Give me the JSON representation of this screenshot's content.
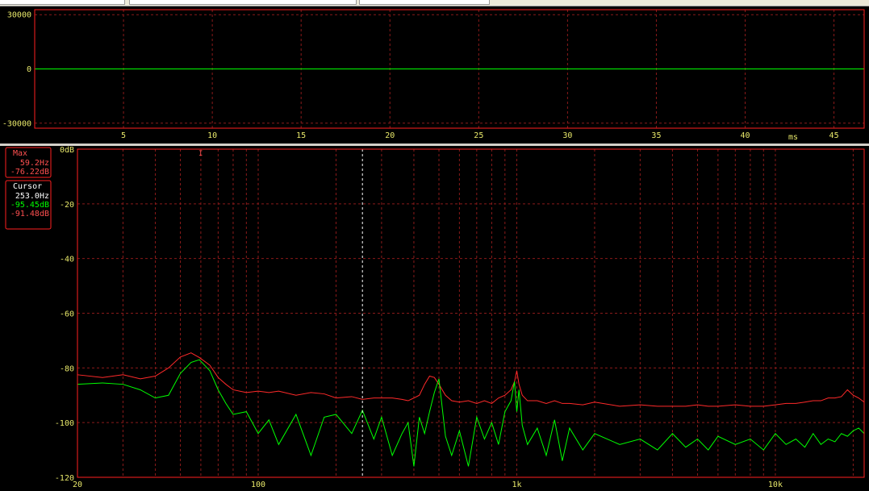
{
  "chart_data": [
    {
      "type": "line",
      "title": "",
      "xunit": "ms",
      "xlim": [
        0,
        46.7
      ],
      "ylim": [
        -32768,
        32767
      ],
      "x_ticks": [
        "5",
        "10",
        "15",
        "20",
        "25",
        "30",
        "35",
        "40",
        "45"
      ],
      "y_ticks": [
        "30000",
        "0",
        "-30000"
      ],
      "grid": true,
      "series": [
        {
          "color": "#00ff00",
          "x": [
            0,
            46.7
          ],
          "y": [
            0,
            0
          ]
        }
      ]
    },
    {
      "type": "line",
      "title": "",
      "xscale": "log",
      "xlim": [
        20,
        22050
      ],
      "ylim": [
        -120,
        0
      ],
      "x_tick_labels": [
        {
          "x": 20,
          "label": "20"
        },
        {
          "x": 100,
          "label": "100"
        },
        {
          "x": 1000,
          "label": "1k"
        },
        {
          "x": 10000,
          "label": "10k"
        }
      ],
      "y_tick_labels": [
        {
          "y": 0,
          "label": "0dB"
        },
        {
          "y": -20,
          "label": "-20"
        },
        {
          "y": -40,
          "label": "-40"
        },
        {
          "y": -60,
          "label": "-60"
        },
        {
          "y": -80,
          "label": "-80"
        },
        {
          "y": -100,
          "label": "-100"
        },
        {
          "y": -120,
          "label": "-120"
        }
      ],
      "grid": true,
      "cursor_x": 253.0,
      "max_marker_x": 59.2,
      "series": [
        {
          "color": "#ff2a2a",
          "x": [
            20,
            25,
            30,
            35,
            40,
            45,
            50,
            55,
            59.2,
            65,
            70,
            75,
            80,
            90,
            100,
            110,
            120,
            140,
            160,
            180,
            200,
            230,
            253,
            280,
            300,
            330,
            360,
            380,
            400,
            420,
            440,
            460,
            480,
            500,
            530,
            560,
            600,
            650,
            700,
            750,
            800,
            850,
            900,
            950,
            980,
            1000,
            1020,
            1050,
            1100,
            1200,
            1300,
            1400,
            1500,
            1600,
            1800,
            2000,
            2500,
            3000,
            3500,
            4000,
            4500,
            5000,
            5500,
            6000,
            7000,
            8000,
            9000,
            10000,
            11000,
            12000,
            13000,
            14000,
            15000,
            16000,
            17000,
            18000,
            19000,
            20000,
            21000,
            22050
          ],
          "y": [
            -82.5,
            -83.5,
            -82.5,
            -84,
            -83,
            -80,
            -76,
            -74.5,
            -76.2,
            -79,
            -83.5,
            -86,
            -88,
            -89,
            -88.5,
            -89,
            -88.5,
            -90,
            -89,
            -89.5,
            -91,
            -90.5,
            -91.5,
            -91,
            -91,
            -91,
            -91.5,
            -92,
            -91,
            -90,
            -86,
            -83,
            -83.5,
            -86,
            -90,
            -92,
            -92.5,
            -92,
            -93,
            -92,
            -93,
            -91,
            -90,
            -88,
            -85,
            -81,
            -86,
            -90,
            -92,
            -92,
            -93,
            -92,
            -93,
            -93,
            -93.5,
            -92.5,
            -94,
            -93.5,
            -94,
            -94,
            -94,
            -93.5,
            -94,
            -94,
            -93.5,
            -94,
            -94,
            -93.5,
            -93,
            -93,
            -92.5,
            -92,
            -92,
            -91,
            -91,
            -90.5,
            -88,
            -90,
            -91,
            -92.5
          ]
        },
        {
          "color": "#00ff00",
          "x": [
            20,
            25,
            30,
            35,
            40,
            45,
            50,
            55,
            59.2,
            65,
            70,
            75,
            80,
            90,
            100,
            110,
            120,
            140,
            160,
            180,
            200,
            230,
            253,
            280,
            300,
            330,
            360,
            380,
            400,
            420,
            440,
            460,
            480,
            500,
            530,
            560,
            600,
            650,
            700,
            750,
            800,
            850,
            900,
            950,
            980,
            1000,
            1020,
            1050,
            1100,
            1200,
            1300,
            1400,
            1500,
            1600,
            1800,
            2000,
            2500,
            3000,
            3500,
            4000,
            4500,
            5000,
            5500,
            6000,
            7000,
            8000,
            9000,
            10000,
            11000,
            12000,
            13000,
            14000,
            15000,
            16000,
            17000,
            18000,
            19000,
            20000,
            21000,
            22050
          ],
          "y": [
            -86,
            -85.5,
            -86,
            -88,
            -91,
            -90,
            -82,
            -78,
            -77,
            -81,
            -88,
            -93,
            -97,
            -96,
            -104,
            -99,
            -108,
            -97,
            -112,
            -98,
            -97,
            -104,
            -95.5,
            -106,
            -98,
            -112,
            -104,
            -100,
            -116,
            -98,
            -104,
            -96,
            -89,
            -84,
            -105,
            -112,
            -103,
            -116,
            -98,
            -106,
            -100,
            -108,
            -96,
            -92,
            -85,
            -96,
            -88,
            -101,
            -108,
            -102,
            -112,
            -99,
            -114,
            -102,
            -110,
            -104,
            -108,
            -106,
            -110,
            -104,
            -109,
            -106,
            -110,
            -105,
            -108,
            -106,
            -110,
            -104,
            -108,
            -106,
            -109,
            -104,
            -108,
            -106,
            -107,
            -104,
            -105,
            -103,
            -102,
            -104
          ]
        }
      ]
    }
  ],
  "readout": {
    "max_title": "Max",
    "max_freq": "59.2Hz",
    "max_level": "-76.22dB",
    "cursor_title": "Cursor",
    "cursor_freq": "253.0Hz",
    "cursor_level_green": "-95.45dB",
    "cursor_level_red": "-91.48dB",
    "max_marker": "I"
  },
  "colors": {
    "background": "#000000",
    "frame": "#ff2020",
    "grid": "#8a1a1a",
    "axis_text": "#e8e86a",
    "cursor": "#ffffff",
    "wave": "#00ff00",
    "spectrum_red": "#ff2a2a",
    "spectrum_green": "#00ff00"
  }
}
